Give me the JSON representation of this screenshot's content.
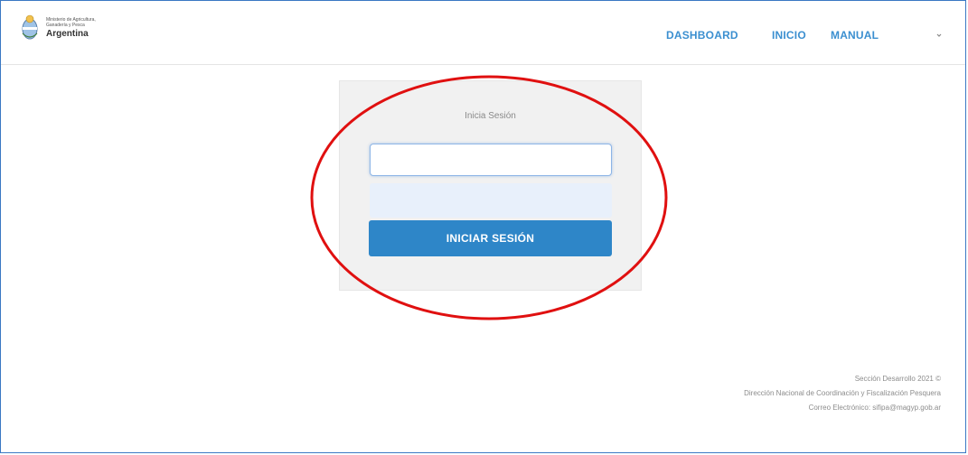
{
  "header": {
    "logo": {
      "line1": "Ministerio de Agricultura,",
      "line2": "Ganadería y Pesca",
      "country": "Argentina"
    },
    "nav": [
      {
        "label": "DASHBOARD"
      },
      {
        "label": "INICIO"
      },
      {
        "label": "MANUAL"
      }
    ],
    "user_menu_icon": "chevron-down-icon"
  },
  "login": {
    "title": "Inicia Sesión",
    "username_value": "",
    "password_value": "",
    "submit_label": "INICIAR SESIÓN"
  },
  "annotation": {
    "color": "#e01010"
  },
  "footer": {
    "line1": "Sección Desarrollo 2021 ©",
    "line2": "Dirección Nacional de Coordinación y Fiscalización Pesquera",
    "line3": "Correo Electrónico: sifipa@magyp.gob.ar"
  },
  "colors": {
    "accent": "#2e86c8",
    "nav_link": "#3b8fd0"
  }
}
